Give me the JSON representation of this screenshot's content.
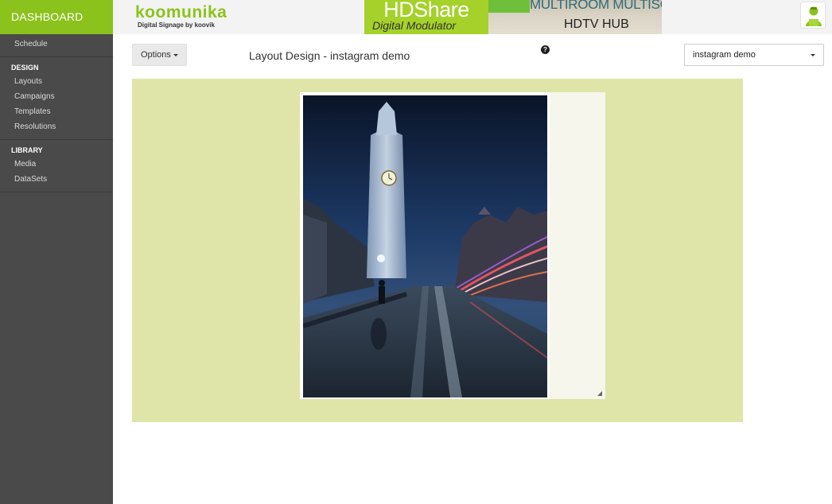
{
  "sidebar": {
    "brand": "DASHBOARD",
    "top_items": [
      {
        "label": "Schedule"
      }
    ],
    "sections": [
      {
        "heading": "DESIGN",
        "items": [
          {
            "label": "Layouts"
          },
          {
            "label": "Campaigns"
          },
          {
            "label": "Templates"
          },
          {
            "label": "Resolutions"
          }
        ]
      },
      {
        "heading": "LIBRARY",
        "items": [
          {
            "label": "Media"
          },
          {
            "label": "DataSets"
          }
        ]
      }
    ]
  },
  "header": {
    "logo_main": "koomunika",
    "logo_sub": "Digital Signage by ",
    "logo_sub_brand": "koovik",
    "banner": {
      "title": "HDShare",
      "subtitle": "Digital Modulator",
      "right_line1": "MULTIROOM MULTISCREEN",
      "right_line2": "HDTV HUB"
    },
    "user_icon": "user-avatar-icon"
  },
  "toolbar": {
    "options_label": "Options",
    "page_title": "Layout Design - instagram demo",
    "help_icon_glyph": "?",
    "layout_select_value": "instagram demo"
  },
  "colors": {
    "brand_green": "#8bc21c",
    "sidebar_bg": "#4a4a4a",
    "canvas_bg": "#dfe5a8",
    "layout_bg": "#f6f6ec"
  }
}
